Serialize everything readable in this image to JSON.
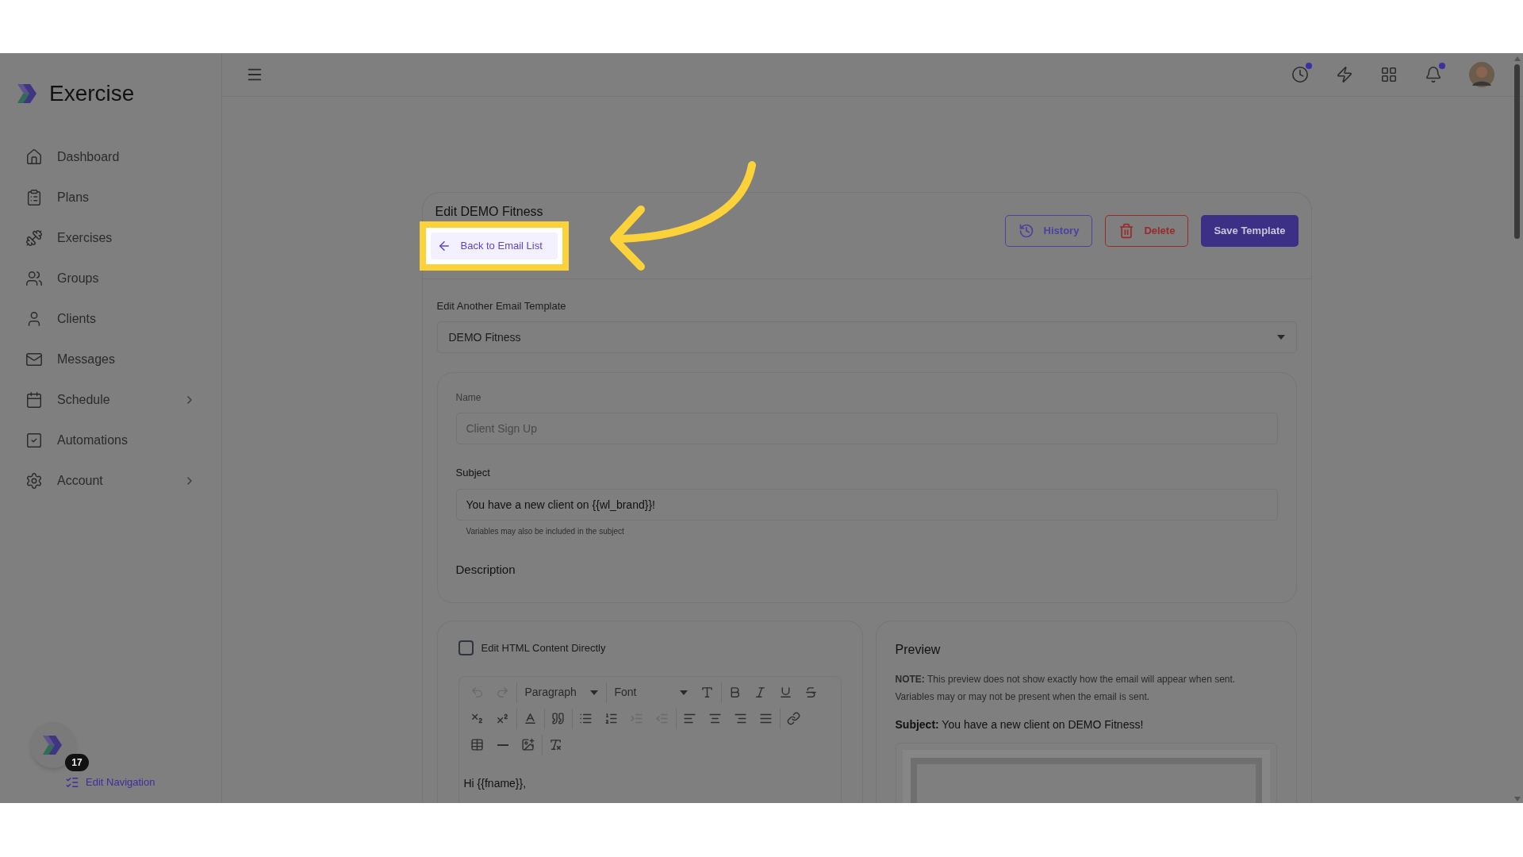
{
  "brand": {
    "name": "Exercise"
  },
  "sidebar": {
    "items": [
      {
        "label": "Dashboard",
        "has_submenu": false
      },
      {
        "label": "Plans",
        "has_submenu": false
      },
      {
        "label": "Exercises",
        "has_submenu": false
      },
      {
        "label": "Groups",
        "has_submenu": false
      },
      {
        "label": "Clients",
        "has_submenu": false
      },
      {
        "label": "Messages",
        "has_submenu": false
      },
      {
        "label": "Schedule",
        "has_submenu": true
      },
      {
        "label": "Automations",
        "has_submenu": false
      },
      {
        "label": "Account",
        "has_submenu": true
      }
    ],
    "chat_badge": "17",
    "edit_link": "Edit Navigation"
  },
  "header": {
    "icons": [
      {
        "dot": true
      },
      {
        "dot": false
      },
      {
        "dot": false
      },
      {
        "dot": true
      }
    ]
  },
  "page": {
    "title": "Edit DEMO Fitness",
    "back_link": "Back to Email List",
    "actions": [
      {
        "kind": "outline",
        "label": "History"
      },
      {
        "kind": "danger",
        "label": "Delete"
      },
      {
        "kind": "primary",
        "label": "Save Template"
      }
    ],
    "template_select": {
      "label": "Edit Another Email Template",
      "value": "DEMO Fitness"
    },
    "name": {
      "label": "Name",
      "placeholder": "Client Sign Up"
    },
    "subject": {
      "label": "Subject",
      "value": "You have a new client on {{wl_brand}}!",
      "hint": "Variables may also be included in the subject"
    },
    "description": {
      "label": "Description"
    }
  },
  "editor": {
    "html_toggle": {
      "label": "Edit HTML Content Directly",
      "checked": false
    },
    "toolbar": [
      [
        [
          {
            "kind": "undo",
            "disabled": true
          },
          {
            "kind": "redo",
            "disabled": true
          }
        ],
        [
          {
            "kind": "select",
            "label": "Paragraph"
          }
        ],
        [
          {
            "kind": "select",
            "label": "Font"
          },
          {
            "kind": "size",
            "disabled": false
          }
        ],
        [
          {
            "kind": "bold",
            "disabled": false
          },
          {
            "kind": "italic",
            "disabled": false
          },
          {
            "kind": "underline",
            "disabled": false
          },
          {
            "kind": "strike",
            "disabled": false
          }
        ]
      ],
      [
        [
          {
            "kind": "subscript",
            "disabled": false
          },
          {
            "kind": "superscript",
            "disabled": false
          }
        ],
        [
          {
            "kind": "color",
            "disabled": false
          }
        ],
        [
          {
            "kind": "quote",
            "disabled": false
          }
        ],
        [
          {
            "kind": "bullets",
            "disabled": false
          },
          {
            "kind": "numbers",
            "disabled": false
          },
          {
            "kind": "indent",
            "disabled": true
          },
          {
            "kind": "outdent",
            "disabled": true
          }
        ],
        [
          {
            "kind": "align-left",
            "disabled": false
          },
          {
            "kind": "align-center",
            "disabled": false
          },
          {
            "kind": "align-right",
            "disabled": false
          },
          {
            "kind": "justify",
            "disabled": false
          }
        ],
        [
          {
            "kind": "link",
            "disabled": false
          }
        ]
      ],
      [
        [
          {
            "kind": "table",
            "disabled": false
          },
          {
            "kind": "rule",
            "disabled": false
          },
          {
            "kind": "image",
            "disabled": false
          }
        ],
        [
          {
            "kind": "clear",
            "disabled": false
          }
        ]
      ]
    ],
    "body": "Hi {{fname}},"
  },
  "preview": {
    "title": "Preview",
    "note": "**NOTE:** This preview does not show exactly how the email will appear when sent. Variables may or may not be present when the email is sent.",
    "subject": "**Subject:** You have a new client on DEMO Fitness!"
  }
}
